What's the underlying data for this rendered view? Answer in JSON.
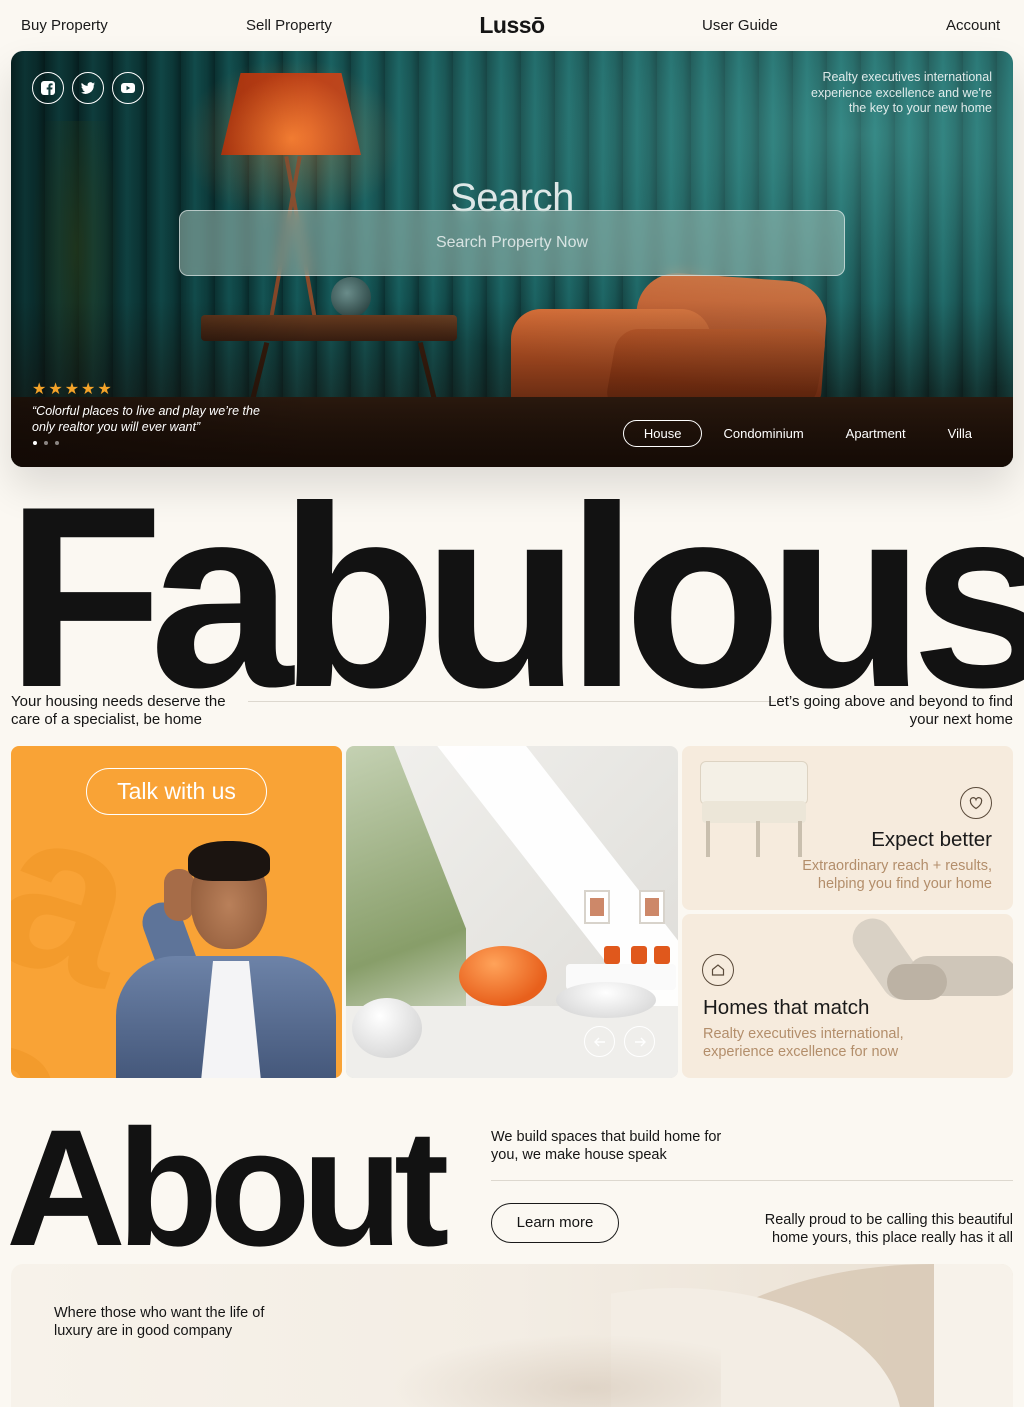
{
  "nav": {
    "buy": "Buy Property",
    "sell": "Sell Property",
    "logo": "Lussō",
    "guide": "User Guide",
    "account": "Account"
  },
  "hero": {
    "tagline": "Realty executives international experience excellence and we're the key to your new home",
    "search_title": "Search",
    "search_placeholder": "Search Property Now",
    "rating_stars": 5,
    "quote": "“Colorful places to live and play we’re the only realtor you will ever want”",
    "slide_count": 3,
    "active_slide": 1,
    "property_types": [
      "House",
      "Condominium",
      "Apartment",
      "Villa"
    ],
    "active_type": "House",
    "socials": [
      "facebook-icon",
      "twitter-icon",
      "youtube-icon"
    ]
  },
  "fabulous": {
    "headline": "Fabulous",
    "left_text": "Your housing needs deserve the care of a specialist, be home",
    "right_text": "Let’s going above and beyond to find your next home"
  },
  "cards": {
    "talk_button": "Talk with us",
    "expect_title": "Expect better",
    "expect_text": "Extraordinary reach + results, helping you find your home",
    "match_title": "Homes that match",
    "match_text": "Realty executives international, experience excellence for now"
  },
  "about": {
    "headline": "About",
    "tagline": "We build spaces that build home for you, we make house speak",
    "button": "Learn more",
    "right_text": "Really proud to be calling this beautiful home yours, this place really has it all",
    "bottom_text": "Where those who want the life of luxury are in good company"
  },
  "colors": {
    "background": "#fbf8f2",
    "accent_orange": "#f9a336",
    "card_beige": "#f6ebdd",
    "star": "#f4a329"
  }
}
